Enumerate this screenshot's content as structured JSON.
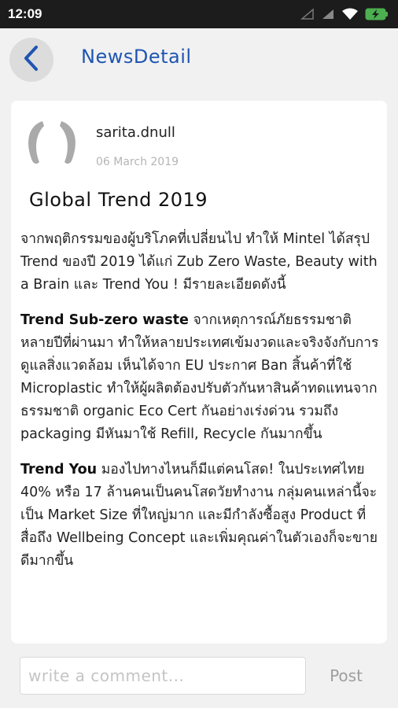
{
  "status_bar": {
    "time": "12:09",
    "icons": [
      "signal-off-icon",
      "signal-icon",
      "wifi-icon",
      "battery-charging-icon"
    ],
    "battery_color": "#4caf50"
  },
  "header": {
    "title": "NewsDetail",
    "back_icon": "chevron-left-icon",
    "accent_color": "#1f55b2"
  },
  "post": {
    "author": "sarita.dnull",
    "date": "06 March 2019",
    "title": "Global Trend 2019",
    "intro": "จากพฤติกรรมของผู้บริโภคที่เปลี่ยนไป ทำให้ Mintel ได้สรุป Trend ของปี 2019 ได้แก่ Zub Zero Waste, Beauty with a Brain และ Trend You ! มีรายละเอียดดังนี้",
    "sections": [
      {
        "heading": "Trend Sub-zero waste",
        "text": " จากเหตุการณ์ภัยธรรมชาติหลายปีที่ผ่านมา ทำให้หลายประเทศเข้มงวดและจริงจังกับการดูแลสิ่งแวดล้อม เห็นได้จาก EU ประกาศ Ban สิ้นค้าที่ใช้ Microplastic ทำให้ผู้ผลิตต้องปรับตัวกันหาสินค้าทดแทนจากธรรมชาติ organic Eco Cert กันอย่างเร่งด่วน รวมถึง packaging มีหันมาใช้ Refill, Recycle กันมากขึ้น"
      },
      {
        "heading": "Trend You",
        "text": " มองไปทางไหนก็มีแต่คนโสด! ในประเทศไทย 40% หรือ 17 ล้านคนเป็นคนโสดวัยทำงาน กลุ่มคนเหล่านี้จะเป็น Market Size ที่ใหญ่มาก และมีกำลังซื้อสูง Product ที่สื่อถึง Wellbeing Concept และเพิ่มคุณค่าในตัวเองก็จะขายดีมากขึ้น"
      }
    ]
  },
  "comment": {
    "placeholder": "write a comment...",
    "value": "",
    "post_label": "Post"
  }
}
